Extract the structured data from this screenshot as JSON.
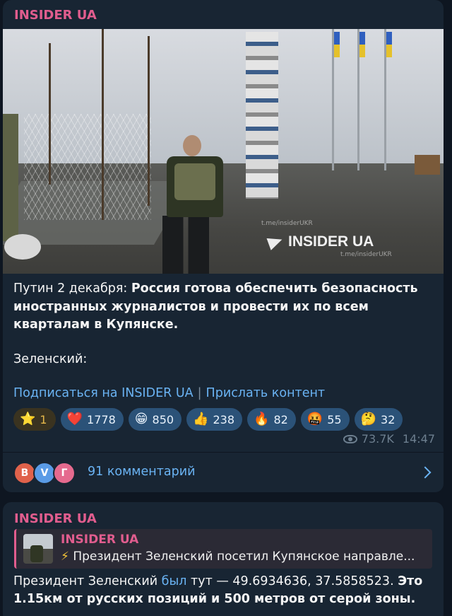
{
  "post1": {
    "channel": "INSIDER UA",
    "image": {
      "watermark": "INSIDER UA",
      "watermark_small": "t.me/insiderUKR"
    },
    "text": {
      "prefix": "Путин 2 декабря: ",
      "bold": "Россия готова обеспечить безопасность иностранных журналистов и провести их по всем кварталам в Купянске.",
      "second": "Зеленский:"
    },
    "links": {
      "subscribe": "Подписаться на INSIDER UA",
      "separator": "|",
      "send": "Прислать контент"
    },
    "reactions": [
      {
        "emoji": "⭐",
        "count": "1",
        "icon": "star-icon"
      },
      {
        "emoji": "❤️",
        "count": "1778",
        "icon": "heart-icon"
      },
      {
        "emoji": "😁",
        "count": "850",
        "icon": "grin-icon"
      },
      {
        "emoji": "👍",
        "count": "238",
        "icon": "thumbs-up-icon"
      },
      {
        "emoji": "🔥",
        "count": "82",
        "icon": "fire-icon"
      },
      {
        "emoji": "🤬",
        "count": "55",
        "icon": "angry-icon"
      },
      {
        "emoji": "🤔",
        "count": "32",
        "icon": "thinking-icon"
      }
    ],
    "views": "73.7K",
    "time": "14:47",
    "comments": {
      "avatars": [
        "В",
        "V",
        "Г"
      ],
      "label": "91 комментарий"
    }
  },
  "post2": {
    "channel": "INSIDER UA",
    "quote": {
      "name": "INSIDER UA",
      "emoji": "⚡",
      "text": "Президент Зеленский посетил Купянское направле..."
    },
    "text": {
      "part1": "Президент Зеленский ",
      "link": "был",
      "part2": " тут — 49.6934636, 37.5858523. ",
      "bold": "Это 1.15км от русских позиций и 500 метров от серой зоны."
    }
  },
  "colors": {
    "background": "#0e1621",
    "bubble": "#182533",
    "channel_name": "#e15d8e",
    "link": "#6ab3f3",
    "reaction_bg": "#2b5278"
  }
}
